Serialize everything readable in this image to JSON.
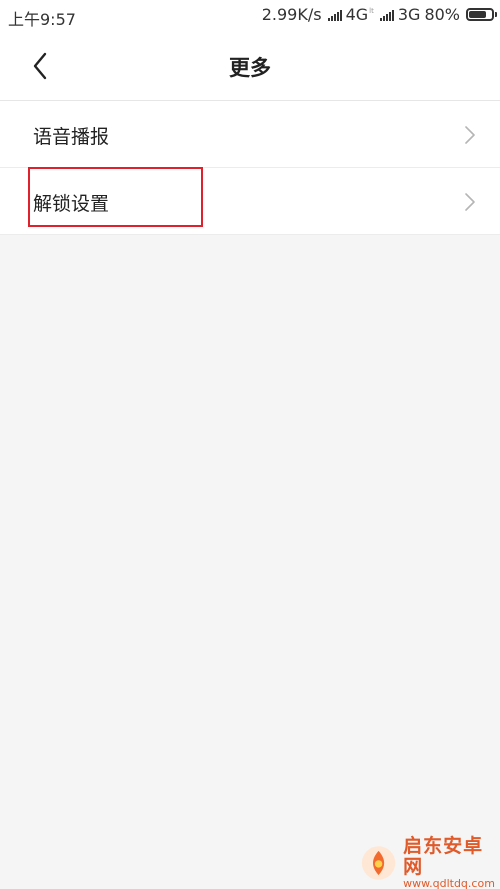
{
  "status_bar": {
    "time": "上午9:57",
    "network_speed": "2.99K/s",
    "network_1": "4G",
    "network_1_sub": "lt",
    "network_2": "3G",
    "battery": "80%",
    "battery_level": 0.8
  },
  "header": {
    "back_icon": "chevron-left-icon",
    "title": "更多"
  },
  "list": {
    "items": [
      {
        "label": "语音播报",
        "icon": "chevron-right-icon"
      },
      {
        "label": "解锁设置",
        "icon": "chevron-right-icon",
        "highlighted": true
      }
    ]
  },
  "watermark": {
    "title": "启东安卓网",
    "url": "www.qdltdq.com"
  },
  "colors": {
    "background": "#f5f5f5",
    "highlight_border": "#e0202a",
    "watermark": "#e05a2a"
  }
}
